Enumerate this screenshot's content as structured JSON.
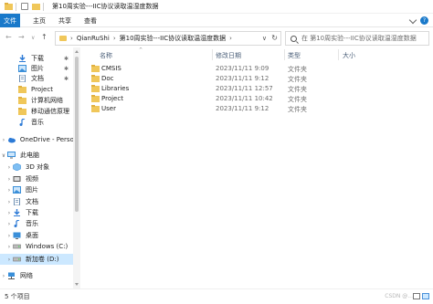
{
  "window": {
    "title": "第10周实验---IIC协议读取温湿度数据"
  },
  "ribbon": {
    "file": "文件",
    "tabs": [
      "主页",
      "共享",
      "查看"
    ]
  },
  "address": {
    "crumbs": [
      "QianRuShi",
      "第10周实验---IIC协议读取温湿度数据"
    ],
    "search_placeholder": "在 第10周实验---IIC协议读取温湿度数据"
  },
  "nav": {
    "items": [
      {
        "label": "下载",
        "icon": "download-icon",
        "pinned": true
      },
      {
        "label": "图片",
        "icon": "pictures-icon",
        "pinned": true
      },
      {
        "label": "文档",
        "icon": "documents-icon",
        "pinned": true
      },
      {
        "label": "Project",
        "icon": "folder-icon",
        "pinned": false
      },
      {
        "label": "计算机网络",
        "icon": "folder-icon",
        "pinned": false
      },
      {
        "label": "移动通信原理",
        "icon": "folder-icon",
        "pinned": false
      },
      {
        "label": "音乐",
        "icon": "music-icon",
        "pinned": false
      },
      {
        "label": "OneDrive - Perso",
        "icon": "cloud-icon",
        "pinned": false
      },
      {
        "label": "此电脑",
        "icon": "computer-icon",
        "pinned": false
      },
      {
        "label": "3D 对象",
        "icon": "cube-icon",
        "pinned": false
      },
      {
        "label": "视频",
        "icon": "video-icon",
        "pinned": false
      },
      {
        "label": "图片",
        "icon": "pictures-icon",
        "pinned": false
      },
      {
        "label": "文档",
        "icon": "documents-icon",
        "pinned": false
      },
      {
        "label": "下载",
        "icon": "download-icon",
        "pinned": false
      },
      {
        "label": "音乐",
        "icon": "music-icon",
        "pinned": false
      },
      {
        "label": "桌面",
        "icon": "desktop-icon",
        "pinned": false
      },
      {
        "label": "Windows (C:)",
        "icon": "drive-icon",
        "pinned": false
      },
      {
        "label": "新加卷 (D:)",
        "icon": "drive-icon",
        "pinned": false,
        "selected": true
      },
      {
        "label": "网络",
        "icon": "network-icon",
        "pinned": false
      }
    ]
  },
  "columns": {
    "name": "名称",
    "date": "修改日期",
    "type": "类型",
    "size": "大小"
  },
  "files": [
    {
      "name": "CMSIS",
      "date": "2023/11/11 9:09",
      "type": "文件夹"
    },
    {
      "name": "Doc",
      "date": "2023/11/11 9:12",
      "type": "文件夹"
    },
    {
      "name": "Libraries",
      "date": "2023/11/11 12:57",
      "type": "文件夹"
    },
    {
      "name": "Project",
      "date": "2023/11/11 10:42",
      "type": "文件夹"
    },
    {
      "name": "User",
      "date": "2023/11/11 9:12",
      "type": "文件夹"
    }
  ],
  "status": {
    "count": "5 个项目",
    "watermark": "CSDN @..."
  },
  "colors": {
    "accent": "#1979ca",
    "folder": "#f0c75a",
    "selection": "#cce8ff",
    "header_text": "#4c607a"
  }
}
